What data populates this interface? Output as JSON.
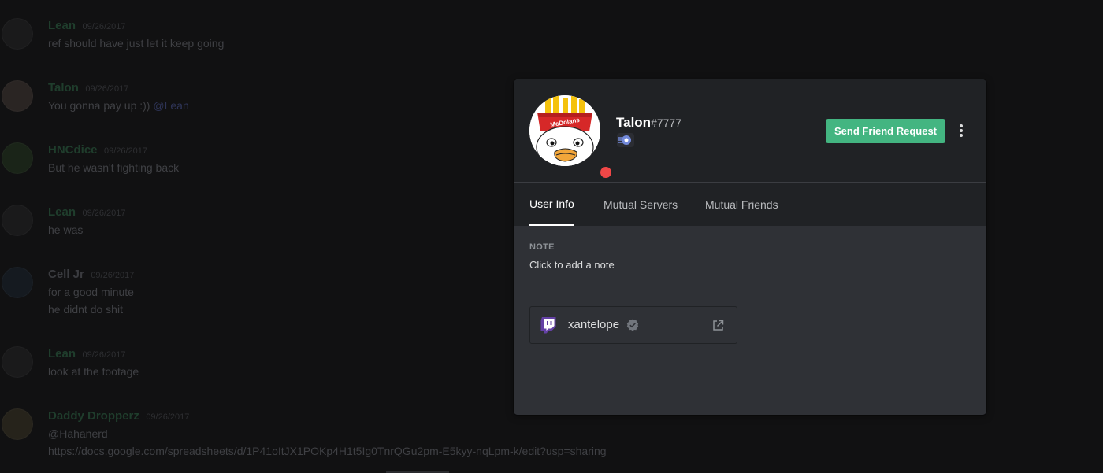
{
  "chat": {
    "messages": [
      {
        "author": "Lean",
        "author_color": "#1f3d2c",
        "time": "09/26/2017",
        "lines": [
          "ref should have just let it keep going"
        ]
      },
      {
        "author": "Talon",
        "author_color": "#1f3d2c",
        "time": "09/26/2017",
        "lines": [
          "You gonna pay up :))"
        ],
        "mention": "@Lean"
      },
      {
        "author": "HNCdice",
        "author_color": "#1f3d2c",
        "time": "09/26/2017",
        "lines": [
          "But he wasn't fighting back"
        ]
      },
      {
        "author": "Lean",
        "author_color": "#1f3d2c",
        "time": "09/26/2017",
        "lines": [
          "he was"
        ]
      },
      {
        "author": "Cell Jr",
        "author_color": "#3a3b3f",
        "time": "09/26/2017",
        "lines": [
          "for a good minute",
          "he didnt do shit"
        ]
      },
      {
        "author": "Lean",
        "author_color": "#1f3d2c",
        "time": "09/26/2017",
        "lines": [
          "look at the footage"
        ]
      },
      {
        "author": "Daddy Dropperz",
        "author_color": "#1f3d2c",
        "time": "09/26/2017",
        "mention_line": "@Hahanerd",
        "link": "https://docs.google.com/spreadsheets/d/1P41oItJX1POKp4H1t5Ig0TnrQGu2pm-E5kyy-nqLpm-k/edit?usp=sharing"
      }
    ]
  },
  "profile": {
    "username": "Talon",
    "discriminator": "#7777",
    "status": "dnd",
    "status_color": "#f04747",
    "avatar_text": "McDolans",
    "friend_button": "Send Friend Request",
    "more_icon": "kebab-menu-icon",
    "badge_icon": "hypesquad-badge-icon",
    "tabs": {
      "user_info": "User Info",
      "mutual_servers": "Mutual Servers",
      "mutual_friends": "Mutual Friends"
    },
    "note_title": "NOTE",
    "note_placeholder": "Click to add a note",
    "connection": {
      "platform": "twitch",
      "icon": "twitch-icon",
      "name": "xantelope",
      "verified": true,
      "link_icon": "external-link-icon"
    },
    "colors": {
      "accent_green": "#43b581",
      "twitch_purple": "#6441a5"
    }
  }
}
